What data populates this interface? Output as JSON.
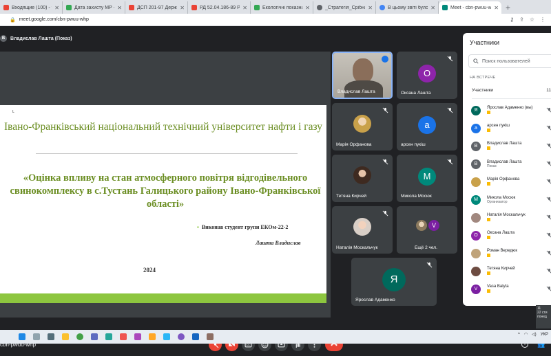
{
  "browser": {
    "tabs": [
      {
        "title": "Входящие (100) - yarad1",
        "color": "#ea4335",
        "active": false
      },
      {
        "title": "Дата захисту МР - Goog",
        "color": "#34a853",
        "active": false
      },
      {
        "title": "ДСП 201-97 Державні са",
        "color": "#ea4335",
        "active": false
      },
      {
        "title": "РД 52.04.186-89 Руковод",
        "color": "#ea4335",
        "active": false
      },
      {
        "title": "Екологічні показники - I",
        "color": "#34a853",
        "active": false
      },
      {
        "title": "_Стратегія_Срібнянськ",
        "color": "#5f6368",
        "active": false
      },
      {
        "title": "В цьому звіті було прове",
        "color": "#4285f4",
        "active": false
      },
      {
        "title": "Meet - cbn-pwuu-wh",
        "color": "#00897b",
        "active": true
      }
    ],
    "url": "meet.google.com/cbn-pwuu-whp"
  },
  "meet": {
    "presenter_label": "Владислав Лашта (Показ)",
    "presenter_initial": "B",
    "meeting_code": "cbn-pwuu-whp"
  },
  "slide": {
    "corner_mark": "ʟ",
    "title": "Івано-Франківський національний технічний університет нафти і газу",
    "topic": "«Оцінка впливу на стан атмосферного повітря відгодівельного свинокомплексу в с.Тустань Галицького району   Івано-Франківської області»",
    "author_line": "Виконав студент групи ЕКОм-22-2",
    "author_name": "Лашта Владислав",
    "year": "2024"
  },
  "tiles": [
    {
      "name": "Владислав Лашта",
      "type": "video"
    },
    {
      "name": "Оксана Лашта",
      "initial": "О",
      "color": "#8e24aa"
    },
    {
      "name": "Марія Орфанова",
      "type": "photo",
      "color": "#c9a14a"
    },
    {
      "name": "арсен пукіш",
      "initial": "а",
      "color": "#1a73e8"
    },
    {
      "name": "Тетяна Кирчей",
      "type": "photo",
      "color": "#6d4c41"
    },
    {
      "name": "Миколa Мосюк",
      "initial": "М",
      "color": "#00897b"
    },
    {
      "name": "Наталія Москальчук",
      "type": "photo",
      "color": "#a1887f"
    },
    {
      "name": "Ещё 2 чел.",
      "initial": "V",
      "color": "#7b1fa2"
    },
    {
      "name": "Ярослав Адаменко",
      "initial": "Я",
      "color": "#00695c"
    }
  ],
  "panel": {
    "title": "Участники",
    "search_placeholder": "Поиск пользователей",
    "section": "НА ВСТРЕЧЕ",
    "sub_label": "Участники",
    "sub_count": "11",
    "participants": [
      {
        "name": "Ярослав Адаменко (вы)",
        "initial": "Я",
        "color": "#00695c",
        "sub": ""
      },
      {
        "name": "арсен пукіш",
        "initial": "а",
        "color": "#1a73e8",
        "sub": ""
      },
      {
        "name": "Владислав Лашта",
        "initial": "B",
        "color": "#5f6368",
        "sub": ""
      },
      {
        "name": "Владислав Лашта",
        "initial": "B",
        "color": "#5f6368",
        "sub": "Показ"
      },
      {
        "name": "Марія Орфанова",
        "initial": "",
        "color": "#c9a14a",
        "sub": ""
      },
      {
        "name": "Микола Мосюк",
        "initial": "M",
        "color": "#00897b",
        "sub": "Организатор"
      },
      {
        "name": "Наталія Москальчук",
        "initial": "",
        "color": "#a1887f",
        "sub": ""
      },
      {
        "name": "Оксана Лашта",
        "initial": "О",
        "color": "#8e24aa",
        "sub": ""
      },
      {
        "name": "Роман Вередюк",
        "initial": "",
        "color": "#bfa37a",
        "sub": ""
      },
      {
        "name": "Тетяна Кирчей",
        "initial": "",
        "color": "#6d4c41",
        "sub": ""
      },
      {
        "name": "Vasa Balyta",
        "initial": "V",
        "color": "#7b1fa2",
        "sub": ""
      }
    ]
  },
  "tray": {
    "lang": "УКР",
    "notif_count": "11",
    "notif_text": "22 сти понед"
  }
}
